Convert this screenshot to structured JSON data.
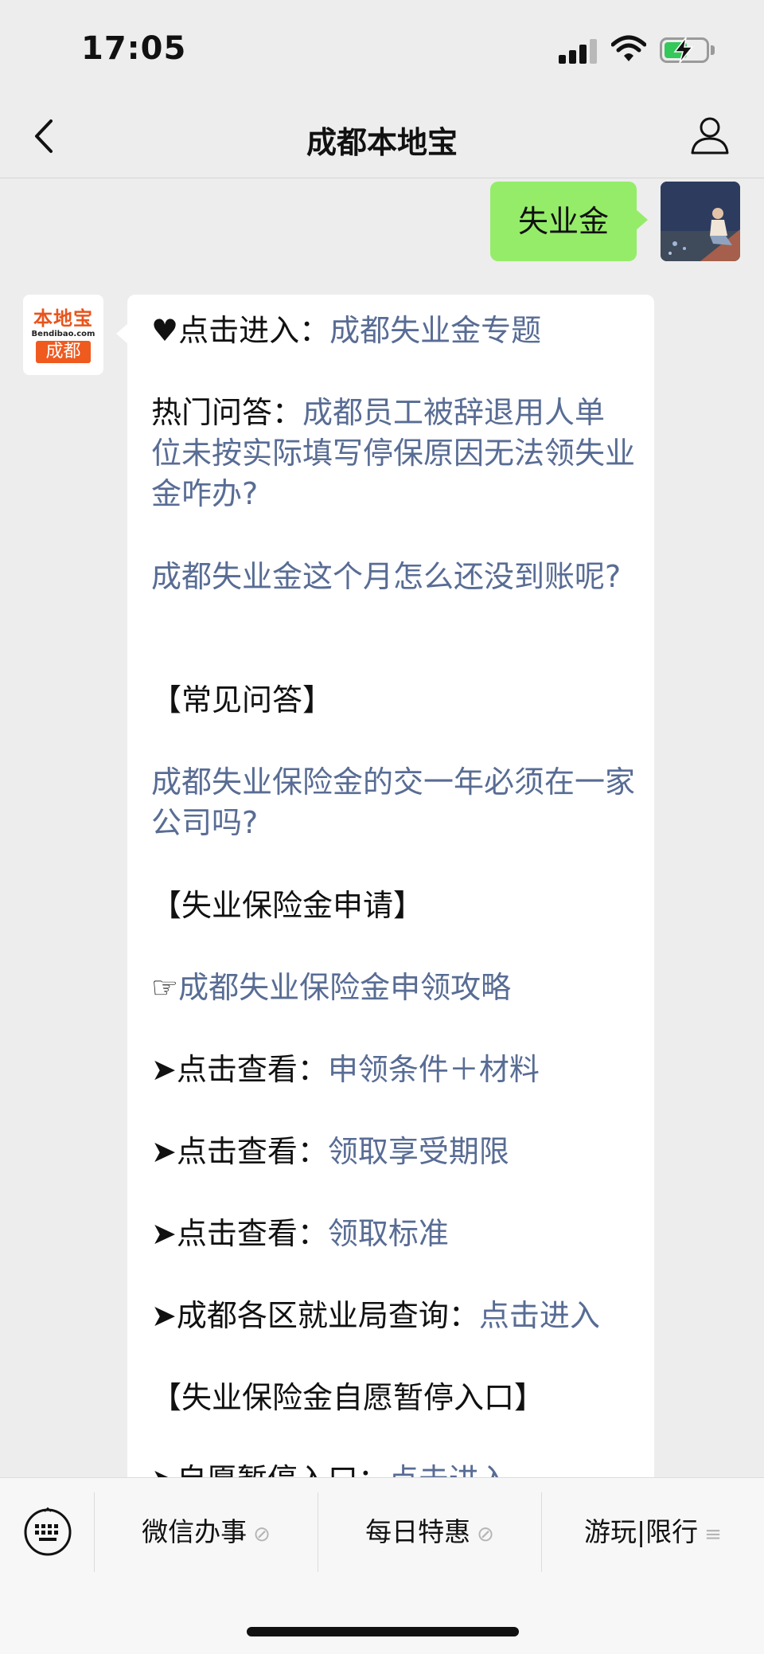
{
  "status": {
    "time": "17:05"
  },
  "nav": {
    "title": "成都本地宝"
  },
  "chat": {
    "user_message": "失业金",
    "bot_logo": {
      "brand": "本地宝",
      "site": "Bendibao.com",
      "city": "成都"
    },
    "lines": [
      {
        "prefix": "♥点击进入：",
        "link": "成都失业金专题"
      },
      {
        "prefix": "热门问答：",
        "link": "成都员工被辞退用人单位未按实际填写停保原因无法领失业金咋办?"
      },
      {
        "prefix": "",
        "link": "成都失业金这个月怎么还没到账呢?"
      },
      {
        "prefix": "【常见问答】",
        "link": ""
      },
      {
        "prefix": "",
        "link": "成都失业保险金的交一年必须在一家公司吗?"
      },
      {
        "prefix": "【失业保险金申请】",
        "link": ""
      },
      {
        "prefix": "☞",
        "link": "成都失业保险金申领攻略"
      },
      {
        "prefix": "➤点击查看：",
        "link": "申领条件＋材料"
      },
      {
        "prefix": "➤点击查看：",
        "link": "领取享受期限"
      },
      {
        "prefix": "➤点击查看：",
        "link": "领取标准"
      },
      {
        "prefix": "➤成都各区就业局查询：",
        "link": "点击进入"
      },
      {
        "prefix": "【失业保险金自愿暂停入口】",
        "link": ""
      },
      {
        "prefix": "➤自愿暂停入口：",
        "link": "点击进入"
      }
    ]
  },
  "menu": {
    "items": [
      {
        "label": "微信办事",
        "suffix": "⊘"
      },
      {
        "label": "每日特惠",
        "suffix": "⊘"
      },
      {
        "label": "游玩|限行",
        "suffix": "≡"
      }
    ]
  },
  "colors": {
    "link": "#586c94",
    "user_bubble": "#95ec69",
    "background": "#ededed"
  }
}
